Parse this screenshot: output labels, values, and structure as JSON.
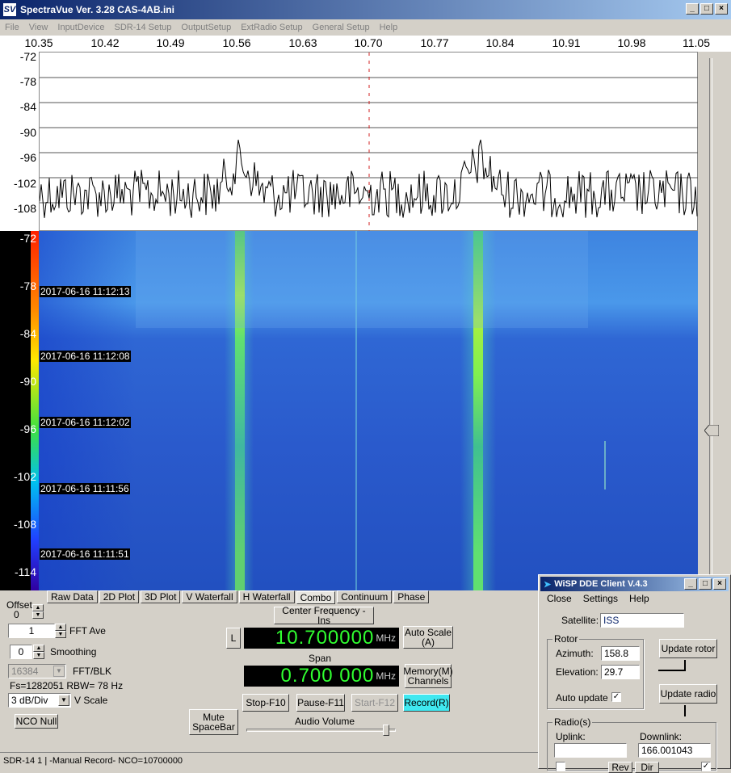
{
  "main_window": {
    "title": "SpectraVue Ver. 3.28 CAS-4AB.ini",
    "icon": "SV",
    "menu": [
      "File",
      "View",
      "InputDevice",
      "SDR-14 Setup",
      "OutputSetup",
      "ExtRadio Setup",
      "General Setup",
      "Help"
    ]
  },
  "frequency_axis": [
    "10.35",
    "10.42",
    "10.49",
    "10.56",
    "10.63",
    "10.70",
    "10.77",
    "10.84",
    "10.91",
    "10.98",
    "11.05"
  ],
  "spectrum_axis": [
    "-72",
    "-78",
    "-84",
    "-90",
    "-96",
    "-102",
    "-108"
  ],
  "waterfall_axis": [
    "-72",
    "-78",
    "-84",
    "-90",
    "-96",
    "-102",
    "-108",
    "-114"
  ],
  "timestamps": [
    "2017-06-16 11:12:13",
    "2017-06-16 11:12:08",
    "2017-06-16 11:12:02",
    "2017-06-16 11:11:56",
    "2017-06-16 11:11:51"
  ],
  "tabs": [
    "Raw Data",
    "2D Plot",
    "3D Plot",
    "V Waterfall",
    "H Waterfall",
    "Combo",
    "Continuum",
    "Phase"
  ],
  "controls": {
    "offset_label": "Offset",
    "offset_value": "0",
    "fft_ave_value": "1",
    "fft_ave_label": "FFT Ave",
    "smoothing_value": "0",
    "smoothing_label": "Smoothing",
    "fft_blk_value": "16384",
    "fft_blk_label": "FFT/BLK",
    "fs_info": "Fs=1282051 RBW= 78 Hz",
    "vscale_value": "3 dB/Div",
    "vscale_label": "V Scale",
    "nco_null": "NCO Null",
    "mute": "Mute SpaceBar",
    "center_freq": "Center Frequency - Ins",
    "l_button": "L",
    "freq_value": "10.700000",
    "freq_unit": "MHz",
    "auto_scale": "Auto Scale (A)",
    "span_label": "Span",
    "span_value": "0.700 000",
    "span_unit": "MHz",
    "memory": "Memory(M) Channels",
    "stop": "Stop-F10",
    "pause": "Pause-F11",
    "start": "Start-F12",
    "record": "Record(R)",
    "audio_volume": "Audio Volume"
  },
  "status": "SDR-14 1  | -Manual Record-   NCO=10700000",
  "wisp": {
    "title": "WiSP DDE Client V.4.3",
    "menu": [
      "Close",
      "Settings",
      "Help"
    ],
    "satellite_label": "Satellite:",
    "satellite_value": "ISS",
    "rotor_group": "Rotor",
    "azimuth_label": "Azimuth:",
    "azimuth_value": "158.8",
    "elevation_label": "Elevation:",
    "elevation_value": "29.7",
    "auto_update_label": "Auto update",
    "update_rotor": "Update rotor",
    "update_radio": "Update radio",
    "radios_group": "Radio(s)",
    "uplink_label": "Uplink:",
    "uplink_value": "",
    "downlink_label": "Downlink:",
    "downlink_value": "166.001043",
    "rev_button": "Rev",
    "dir_button": "Dir"
  }
}
